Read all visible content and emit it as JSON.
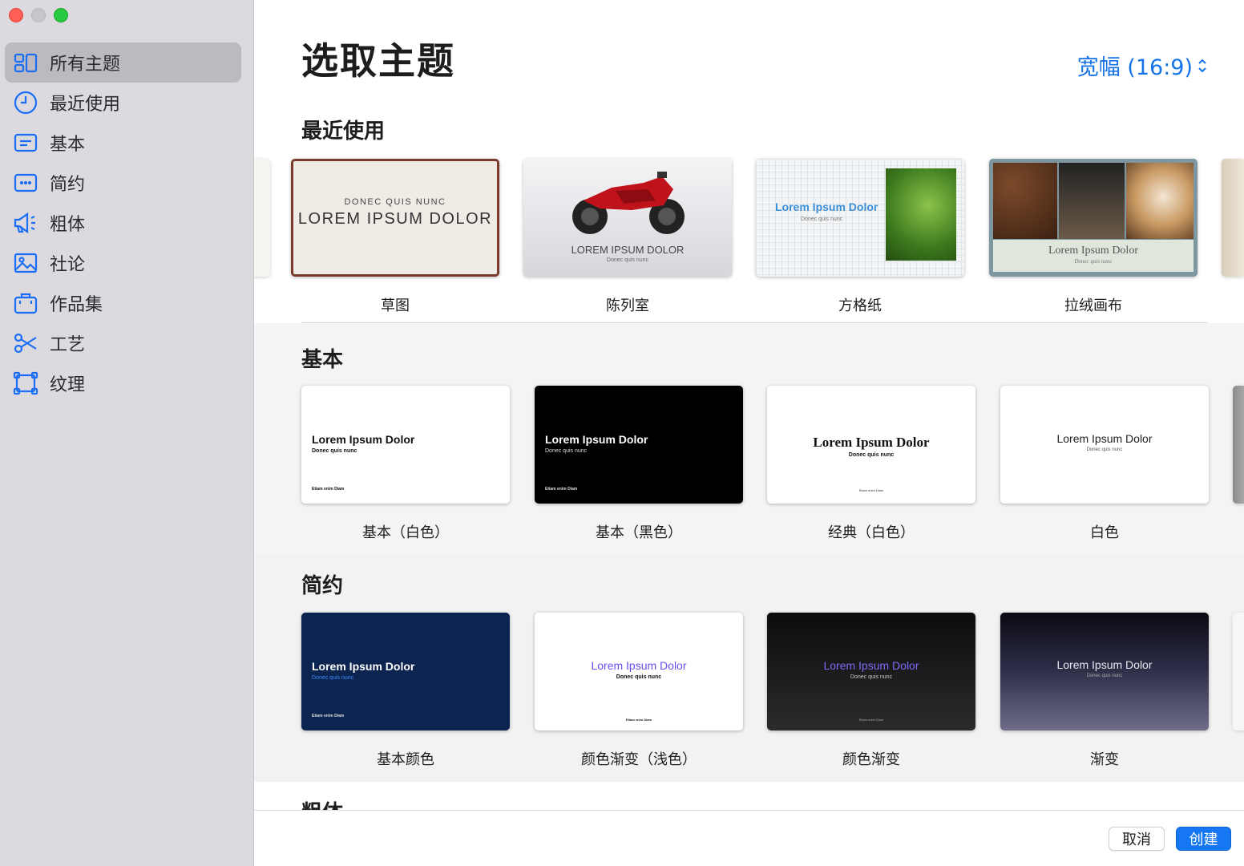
{
  "window": {
    "title": "选取主题"
  },
  "sidebar": {
    "items": [
      {
        "label": "所有主题",
        "icon": "grid-icon",
        "active": true
      },
      {
        "label": "最近使用",
        "icon": "clock-icon"
      },
      {
        "label": "基本",
        "icon": "rectangle-lines-icon"
      },
      {
        "label": "简约",
        "icon": "ellipsis-rectangle-icon"
      },
      {
        "label": "粗体",
        "icon": "megaphone-icon"
      },
      {
        "label": "社论",
        "icon": "photo-icon"
      },
      {
        "label": "作品集",
        "icon": "briefcase-icon"
      },
      {
        "label": "工艺",
        "icon": "scissors-icon"
      },
      {
        "label": "纹理",
        "icon": "frame-icon"
      }
    ]
  },
  "header": {
    "title": "选取主题",
    "aspect": "宽幅 (16:9)"
  },
  "sections": {
    "recent": {
      "title": "最近使用",
      "themes": [
        {
          "caption": "草图",
          "line1": "DONEC QUIS NUNC",
          "line2": "LOREM IPSUM DOLOR"
        },
        {
          "caption": "陈列室",
          "line1": "LOREM IPSUM DOLOR",
          "line2": "Donec quis nunc"
        },
        {
          "caption": "方格纸",
          "line1": "Lorem Ipsum Dolor",
          "line2": "Donec quis nunc"
        },
        {
          "caption": "拉绒画布",
          "line1": "Lorem Ipsum Dolor",
          "line2": "Donec quis nunc"
        }
      ]
    },
    "basic": {
      "title": "基本",
      "themes": [
        {
          "caption": "基本（白色）",
          "line1": "Lorem Ipsum Dolor",
          "line2": "Donec quis nunc",
          "line3": "Etiam enim Diam"
        },
        {
          "caption": "基本（黑色）",
          "line1": "Lorem Ipsum Dolor",
          "line2": "Donec quis nunc",
          "line3": "Etiam enim Diam"
        },
        {
          "caption": "经典（白色）",
          "line1": "Lorem Ipsum Dolor",
          "line2": "Donec quis nunc",
          "line3": "Etiam enim Diam"
        },
        {
          "caption": "白色",
          "line1": "Lorem Ipsum Dolor",
          "line2": "Donec quis nunc"
        }
      ]
    },
    "minimal": {
      "title": "简约",
      "themes": [
        {
          "caption": "基本颜色",
          "line1": "Lorem Ipsum Dolor",
          "line2": "Donec quis nunc",
          "line3": "Etiam enim Diam"
        },
        {
          "caption": "颜色渐变（浅色）",
          "line1": "Lorem Ipsum Dolor",
          "line2": "Donec quis nunc",
          "line3": "Etiam enim Diam"
        },
        {
          "caption": "颜色渐变",
          "line1": "Lorem Ipsum Dolor",
          "line2": "Donec quis nunc",
          "line3": "Etiam enim Diam"
        },
        {
          "caption": "渐变",
          "line1": "Lorem Ipsum Dolor",
          "line2": "Donec quis nunc"
        }
      ]
    },
    "bold": {
      "title": "粗体"
    }
  },
  "footer": {
    "cancel": "取消",
    "create": "创建"
  },
  "colors": {
    "accent": "#1473e6",
    "create_button": "#1677f2",
    "sidebar_bg": "#dcdadf",
    "sidebar_active": "#bcbac0"
  }
}
